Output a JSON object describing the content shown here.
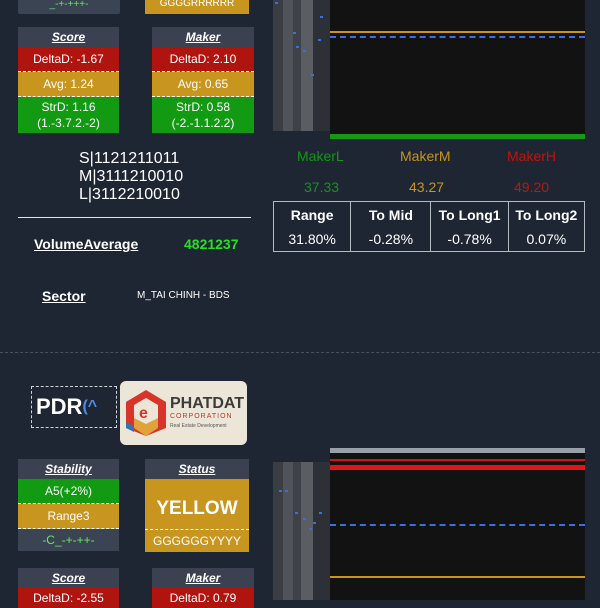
{
  "top_section": {
    "stability_sub": "_-+-+++-",
    "status_sub": "GGGGRRRRRR",
    "score_card": {
      "title": "Score",
      "delta": "DeltaD: -1.67",
      "avg": "Avg: 1.24",
      "strd": "StrD: 1.16",
      "strd_detail": "(1.-3.7.2.-2)"
    },
    "maker_card": {
      "title": "Maker",
      "delta": "DeltaD: 2.10",
      "avg": "Avg: 0.65",
      "strd": "StrD: 0.58",
      "strd_detail": "(-2.-1.1.2.2)"
    },
    "sml_lines": [
      "S|1121211011",
      "M|3111210010",
      "L|3112210010"
    ],
    "volume_label": "VolumeAverage",
    "volume_value": "4821237",
    "sector_label": "Sector",
    "sector_value": "M_TAI CHINH - BDS",
    "makers": [
      {
        "label": "MakerL",
        "value": "37.33",
        "color": "#15931a"
      },
      {
        "label": "MakerM",
        "value": "43.27",
        "color": "#c8951e"
      },
      {
        "label": "MakerH",
        "value": "49.20",
        "color": "#c0140f"
      }
    ],
    "table": {
      "headers": [
        "Range",
        "To Mid",
        "To Long1",
        "To Long2"
      ],
      "values": [
        "31.80%",
        "-0.28%",
        "-0.78%",
        "0.07%"
      ]
    }
  },
  "bottom_section": {
    "ticker": "PDR",
    "ticker_suffix": "(^",
    "logo": {
      "name": "PHATDAT",
      "sub": "CORPORATION",
      "tagline": "Real Estate Development"
    },
    "stability_card": {
      "title": "Stability",
      "row1": "A5(+2%)",
      "row2": "Range3",
      "row3": "-C_-+-++-"
    },
    "status_card": {
      "title": "Status",
      "value": "YELLOW",
      "sub": "GGGGGGYYYY"
    },
    "score_title": "Score",
    "score_delta": "DeltaD: -2.55",
    "maker_title": "Maker",
    "maker_delta": "DeltaD: 0.79"
  },
  "colors": {
    "background": "#1f2633",
    "red": "#b0140f",
    "gold": "#c8951e",
    "green": "#129a12",
    "dots": "#3a6fe0"
  }
}
